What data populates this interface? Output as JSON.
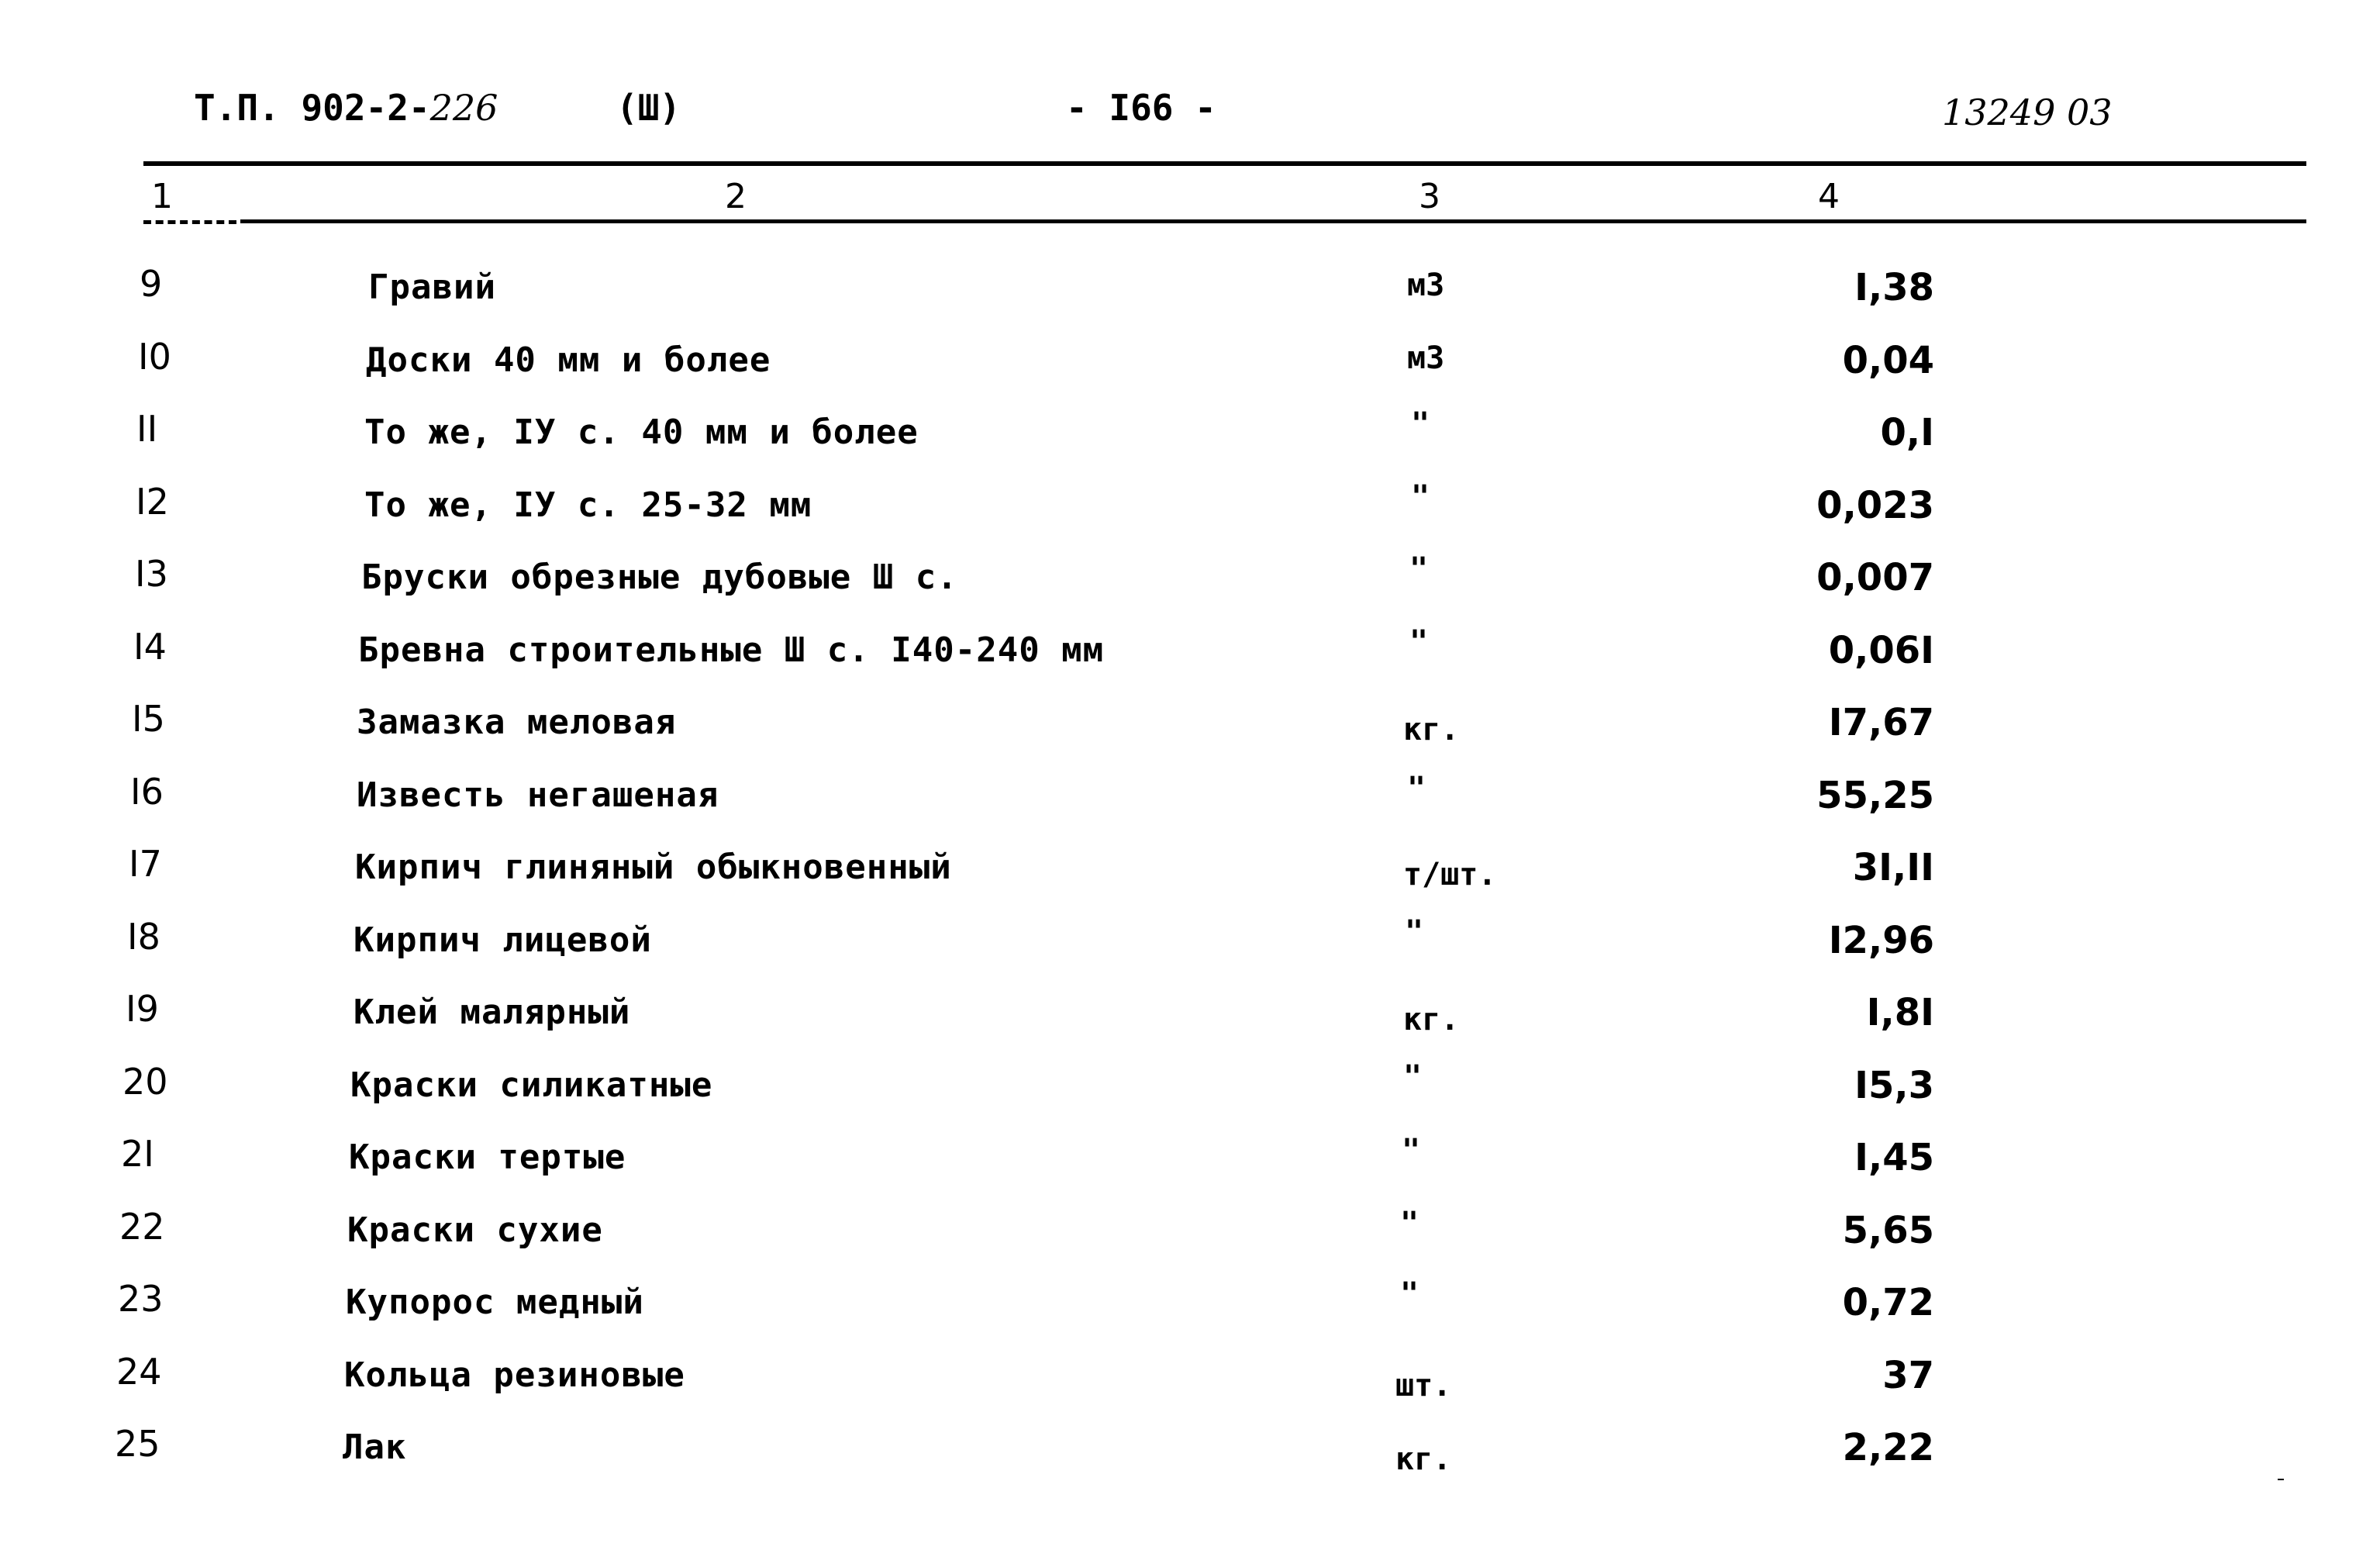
{
  "header": {
    "doc_code": "Т.П. 902-2-",
    "doc_code_handwritten": "226",
    "section": "(Ш)",
    "page_number": "- I66 -",
    "stamp_number": "13249 03"
  },
  "table": {
    "column_numbers": [
      "1",
      "2",
      "3",
      "4"
    ],
    "rows": [
      {
        "no": "9",
        "name": "Гравий",
        "unit": "м3",
        "qty": "I,38"
      },
      {
        "no": "I0",
        "name": "Доски 40 мм и более",
        "unit": "м3",
        "qty": "0,04"
      },
      {
        "no": "II",
        "name": "То же, IУ с. 40 мм и более",
        "unit": "\"",
        "qty": "0,I"
      },
      {
        "no": "I2",
        "name": "То же, IУ с. 25-32 мм",
        "unit": "\"",
        "qty": "0,023"
      },
      {
        "no": "I3",
        "name": "Бруски обрезные дубовые Ш с.",
        "unit": "\"",
        "qty": "0,007"
      },
      {
        "no": "I4",
        "name": "Бревна строительные Ш с. I40-240 мм",
        "unit": "\"",
        "qty": "0,06I"
      },
      {
        "no": "I5",
        "name": "Замазка меловая",
        "unit": "кг.",
        "qty": "I7,67"
      },
      {
        "no": "I6",
        "name": "Известь негашеная",
        "unit": "\"",
        "qty": "55,25"
      },
      {
        "no": "I7",
        "name": "Кирпич глиняный обыкновенный",
        "unit": "т/шт.",
        "qty": "3I,II"
      },
      {
        "no": "I8",
        "name": "Кирпич лицевой",
        "unit": "\"",
        "qty": "I2,96"
      },
      {
        "no": "I9",
        "name": "Клей малярный",
        "unit": "кг.",
        "qty": "I,8I"
      },
      {
        "no": "20",
        "name": "Краски силикатные",
        "unit": "\"",
        "qty": "I5,3"
      },
      {
        "no": "2I",
        "name": "Краски тертые",
        "unit": "\"",
        "qty": "I,45"
      },
      {
        "no": "22",
        "name": "Краски сухие",
        "unit": "\"",
        "qty": "5,65"
      },
      {
        "no": "23",
        "name": "Купорос медный",
        "unit": "\"",
        "qty": "0,72"
      },
      {
        "no": "24",
        "name": "Кольца резиновые",
        "unit": "шт.",
        "qty": "37"
      },
      {
        "no": "25",
        "name": "Лак",
        "unit": "кг.",
        "qty": "2,22"
      }
    ]
  }
}
